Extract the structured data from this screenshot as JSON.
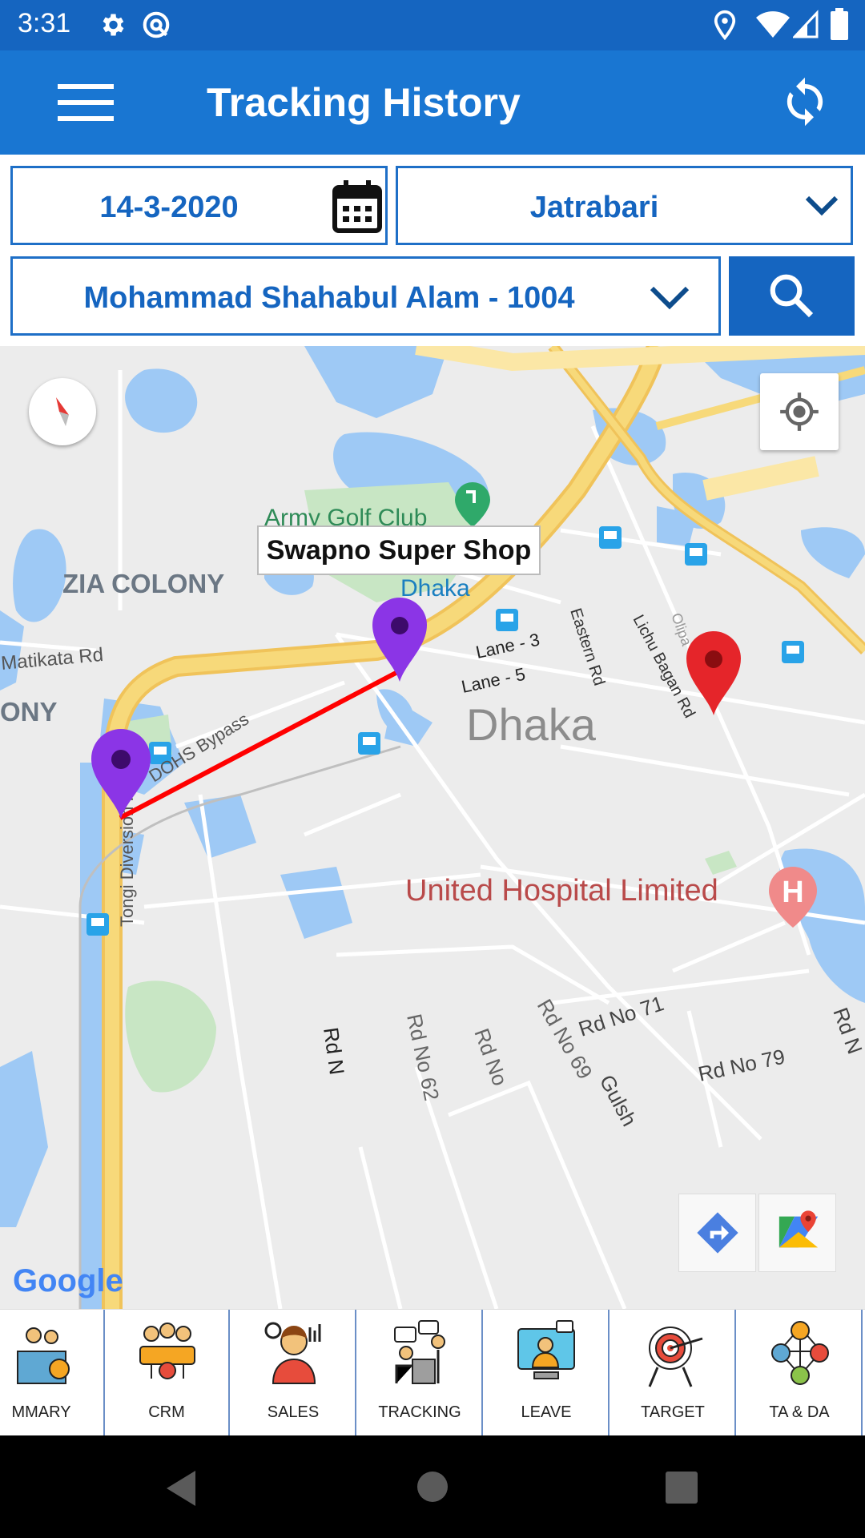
{
  "status_bar": {
    "time": "3:31",
    "icons": [
      "settings-icon",
      "sync-icon",
      "location-icon",
      "wifi-icon",
      "signal-icon",
      "battery-icon"
    ]
  },
  "app_bar": {
    "title": "Tracking History",
    "menu_icon": "hamburger-menu-icon",
    "refresh_icon": "refresh-icon"
  },
  "filters": {
    "date": "14-3-2020",
    "area": "Jatrabari",
    "employee": "Mohammad Shahabul Alam  - 1004"
  },
  "map": {
    "labels": {
      "army_golf_club": "Army Golf Club",
      "zia_colony": "ZIA COLONY",
      "ony": "ONY",
      "matikata_rd": "Matikata Rd",
      "dohs_bypass": "DOHS Bypass",
      "tongi_diversion": "Tongi Diversion Rd",
      "dhaka_small": "Dhaka",
      "dhaka_big": "Dhaka",
      "lane3": "Lane - 3",
      "lane5": "Lane - 5",
      "eastern_rd": "Eastern Rd",
      "lichu_bagan": "Lichu Bagan Rd",
      "olipa": "Olipa",
      "united_hospital": "United Hospital Limited",
      "rd71": "Rd No 71",
      "rd79": "Rd No 79",
      "rd69": "Rd No 69",
      "rd62": "Rd No 62",
      "rdno": "Rd No",
      "rdn": "Rd N",
      "gulshan": "Gulsh",
      "rdn_right": "Rd N"
    },
    "marker_popup": "Swapno Super Shop",
    "google_logo": "Google",
    "colors": {
      "route": "#ff0000",
      "pin_purple": "#8b35e6",
      "pin_red": "#e5252a",
      "water": "#9ec9f5",
      "park": "#c8e6c4",
      "highway": "#f7d97a"
    }
  },
  "bottom_nav": [
    {
      "label": "MMARY",
      "icon": "summary-icon"
    },
    {
      "label": "CRM",
      "icon": "crm-team-icon"
    },
    {
      "label": "SALES",
      "icon": "sales-person-icon"
    },
    {
      "label": "TRACKING",
      "icon": "tracking-meeting-icon"
    },
    {
      "label": "LEAVE",
      "icon": "leave-computer-icon"
    },
    {
      "label": "TARGET",
      "icon": "target-arrow-icon"
    },
    {
      "label": "TA & DA",
      "icon": "network-people-icon"
    }
  ]
}
